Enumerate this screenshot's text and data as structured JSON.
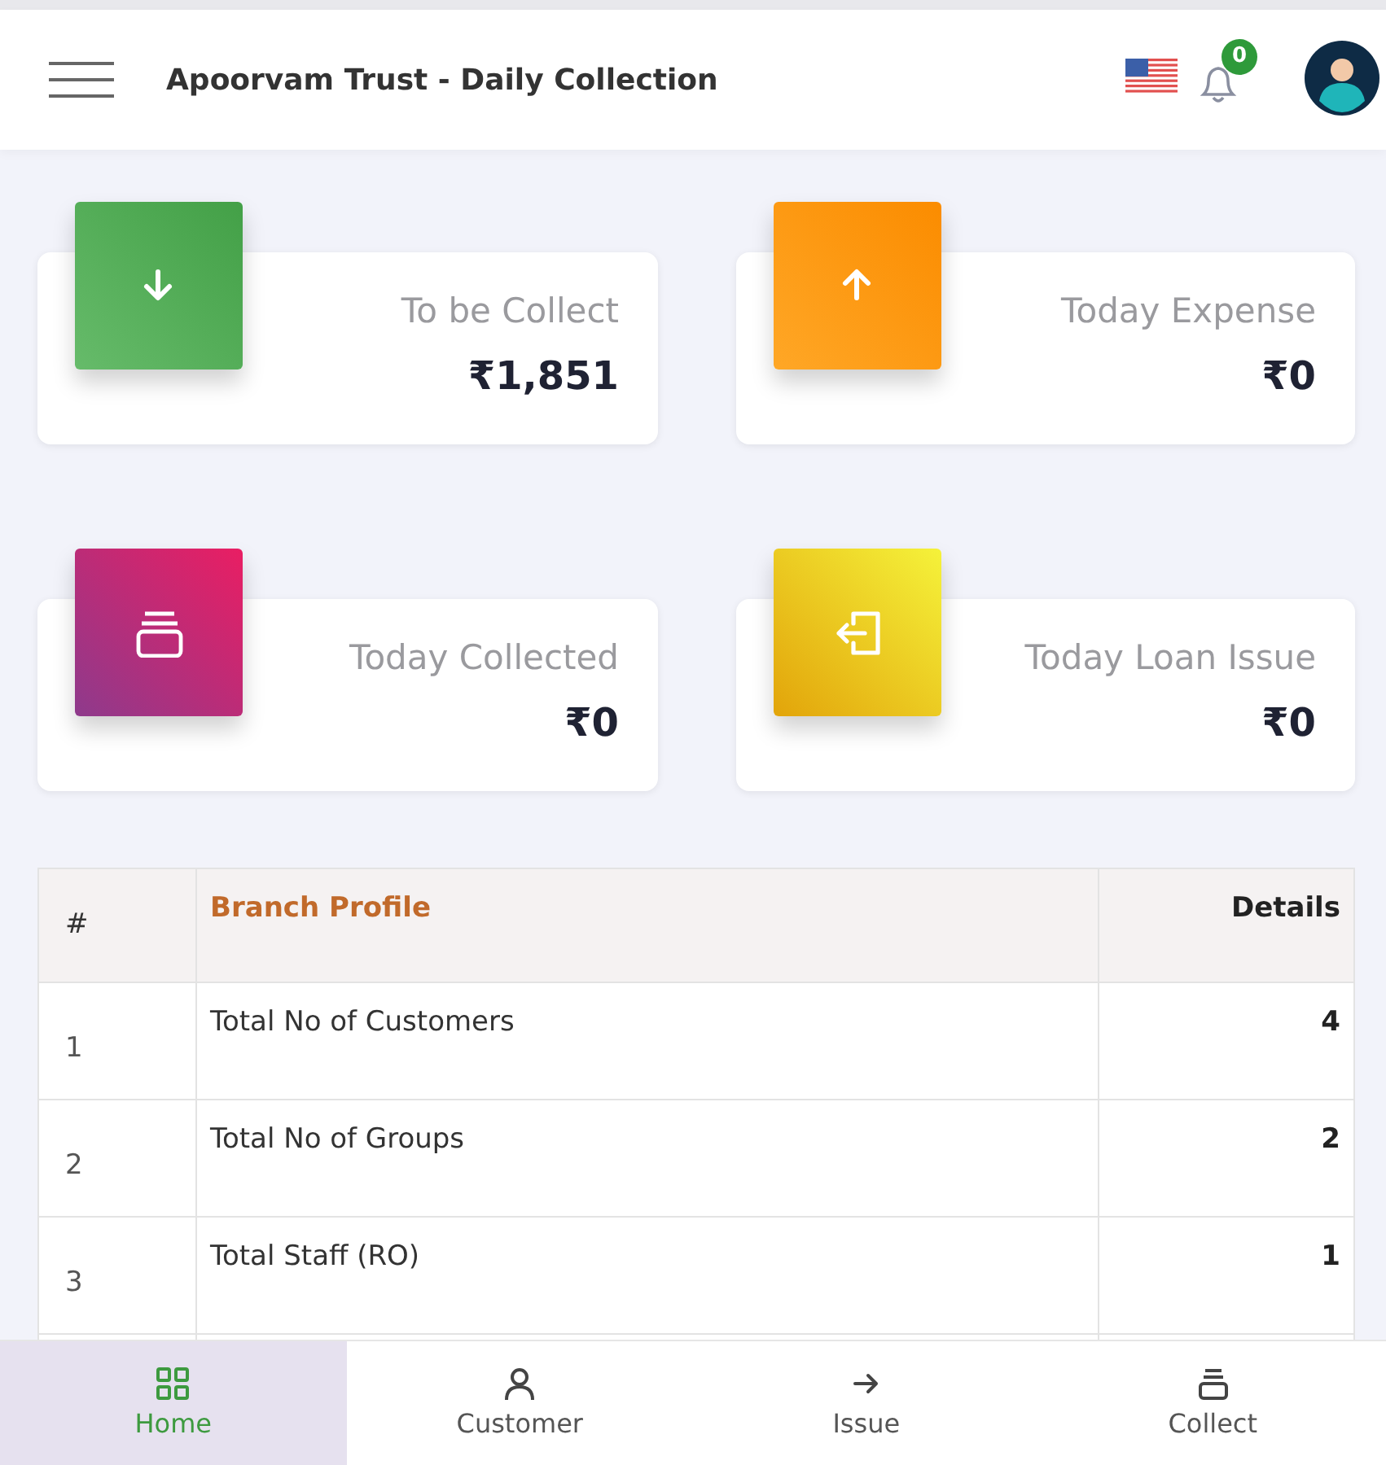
{
  "header": {
    "title": "Apoorvam Trust - Daily Collection",
    "notification_count": "0"
  },
  "cards": [
    {
      "label": "To be Collect",
      "value": "₹1,851"
    },
    {
      "label": "Today Expense",
      "value": "₹0"
    },
    {
      "label": "Today Collected",
      "value": "₹0"
    },
    {
      "label": "Today Loan Issue",
      "value": "₹0"
    }
  ],
  "table": {
    "columns": [
      "#",
      "Branch Profile",
      "Details"
    ],
    "rows": [
      {
        "index": "1",
        "name": "Total No of Customers",
        "value": "4"
      },
      {
        "index": "2",
        "name": "Total No of Groups",
        "value": "2"
      },
      {
        "index": "3",
        "name": "Total Staff (RO)",
        "value": "1"
      }
    ]
  },
  "nav": [
    {
      "label": "Home",
      "selected": true
    },
    {
      "label": "Customer",
      "selected": false
    },
    {
      "label": "Issue",
      "selected": false
    },
    {
      "label": "Collect",
      "selected": false
    }
  ]
}
